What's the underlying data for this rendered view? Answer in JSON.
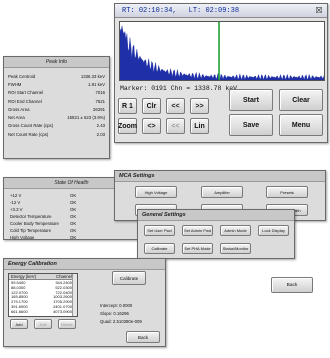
{
  "mca": {
    "rt_label": "RT:",
    "rt_value": "02:10:34,",
    "lt_label": "LT:",
    "lt_value": "02:09:38",
    "close_glyph": "☒",
    "marker_text": "Marker: 0191 Chn  =     1338.78 keV",
    "buttons": {
      "r1": "R 1",
      "clr": "Clr",
      "left_left": "<<",
      "right_right": ">>",
      "zoom": "Zoom",
      "left_right": "<>",
      "left_left_2": "<<",
      "lin": "Lin",
      "start": "Start",
      "clear": "Clear",
      "save": "Save",
      "menu": "Menu"
    },
    "colors": {
      "spectrum": "#1f2fa8",
      "marker": "#1e9e2e",
      "title_text": "#0a2a9a"
    }
  },
  "peak_info": {
    "title": "Peak Info",
    "rows": [
      {
        "label": "Peak Centroid",
        "value": "1336.33 keV"
      },
      {
        "label": "FWHM",
        "value": "1.91 keV"
      },
      {
        "label": "ROI Start Channel",
        "value": "7016"
      },
      {
        "label": "ROI End Channel",
        "value": "7521"
      },
      {
        "label": "Gross Area",
        "value": "26291"
      },
      {
        "label": "Net Area",
        "value": "15821 ± 623 (3.9%)"
      },
      {
        "label": "Gross Count Rate (cps)",
        "value": "2.43"
      },
      {
        "label": "Net Count Rate (cps)",
        "value": "2.03"
      }
    ]
  },
  "state_of_health": {
    "title": "State Of Health",
    "rows": [
      {
        "label": "+12 V",
        "value": "OK"
      },
      {
        "label": "-12 V",
        "value": "OK"
      },
      {
        "label": "+3.3 V",
        "value": "OK"
      },
      {
        "label": "Detector Temperature",
        "value": "OK"
      },
      {
        "label": "Cooler Body Temperature",
        "value": "OK"
      },
      {
        "label": "Cold Tip Temperature",
        "value": "OK"
      },
      {
        "label": "High Voltage",
        "value": "OK"
      }
    ]
  },
  "mca_settings": {
    "title": "MCA Settings",
    "buttons": [
      "High Voltage",
      "Amplifier",
      "Presets",
      "ADC Settings",
      "Stabilizer",
      "State Of Health"
    ]
  },
  "general_settings": {
    "title": "General Settings",
    "buttons": [
      "Set User Pwd",
      "Set Admin Pwd",
      "Admin Mode",
      "Lock Display",
      "Calibrate",
      "Set PHA Mode",
      "Status/Monitor"
    ]
  },
  "energy_calibration": {
    "title": "Energy Calibration",
    "table": {
      "headers": [
        "Energy (keV)",
        "Channel"
      ],
      "rows": [
        [
          "59.5400",
          "344.2400"
        ],
        [
          "88.0300",
          "522.0300"
        ],
        [
          "122.0700",
          "722.0400"
        ],
        [
          "165.8500",
          "1003.2600"
        ],
        [
          "279.1700",
          "1705.2900"
        ],
        [
          "391.6900",
          "2401.0700"
        ],
        [
          "661.6600",
          "4073.0900"
        ]
      ]
    },
    "calibrate_label": "Calibrate",
    "add_label": "Add",
    "edit_label": "Edit",
    "delete_label": "Delete",
    "stats": {
      "intercept": "Intercept: 0.0000",
      "slope": "Slope: 0.16296",
      "quad": "Quad: 2.510380e-009"
    },
    "back_label": "Back"
  },
  "general_back_label": "Back"
}
